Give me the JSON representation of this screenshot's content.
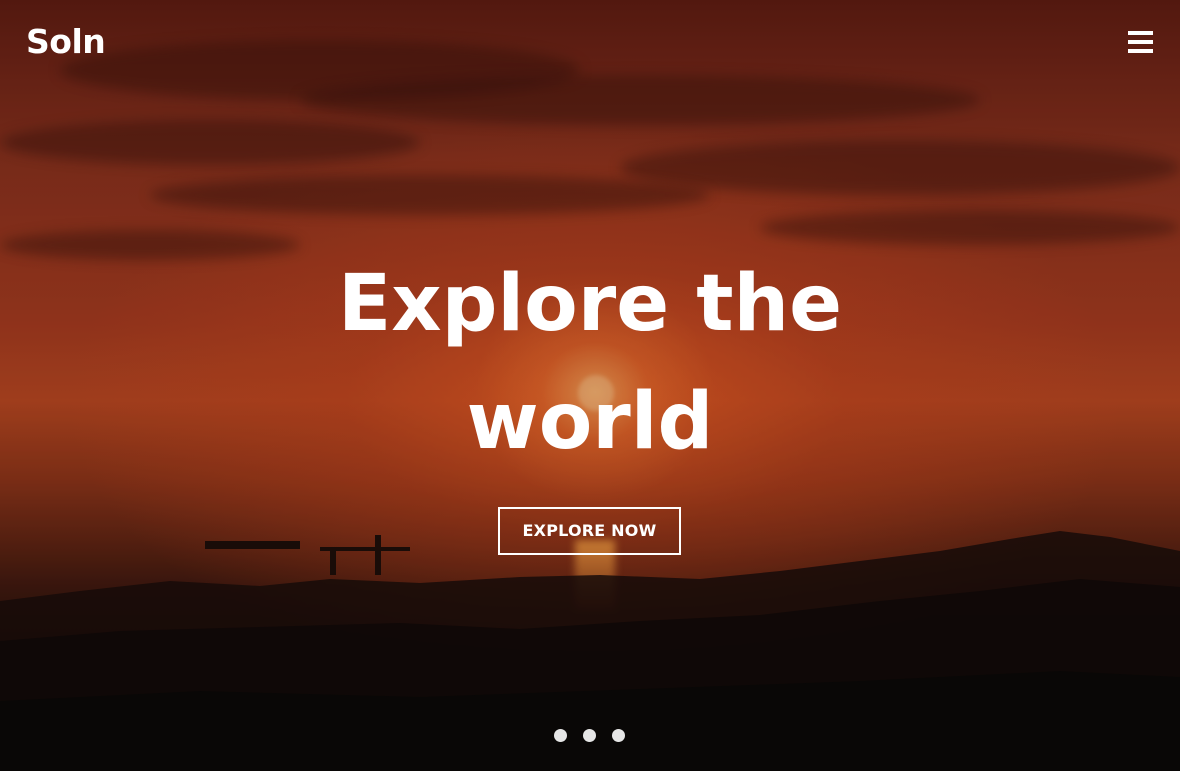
{
  "brand": {
    "logo_text": "Soln"
  },
  "nav": {
    "menu_icon": "hamburger-menu-icon"
  },
  "hero": {
    "headline_line1": "Explore the",
    "headline_line2": "world",
    "cta_label": "EXPLORE NOW",
    "slide_indicator": {
      "count": 3,
      "active_index": 0
    }
  },
  "colors": {
    "text": "#ffffff",
    "sky_top": "#5e1c12",
    "sky_mid": "#a33a1f",
    "ground": "#0c0908"
  }
}
